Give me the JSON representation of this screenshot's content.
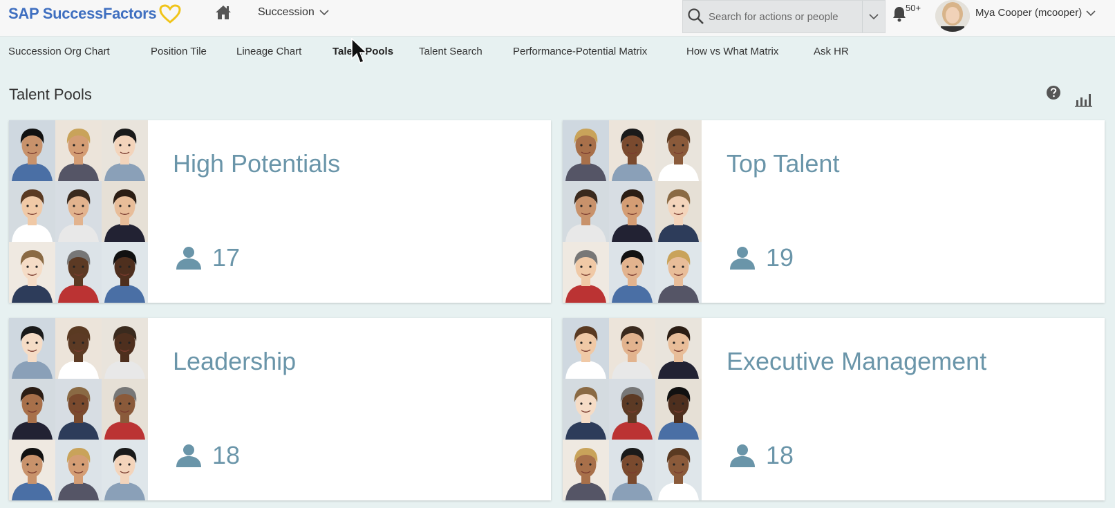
{
  "header": {
    "brand": "SAP SuccessFactors",
    "module": "Succession",
    "search_placeholder": "Search for actions or people",
    "notification_count": "50+",
    "user_name": "Mya Cooper (mcooper)"
  },
  "subnav": {
    "items": [
      {
        "label": "Succession Org Chart"
      },
      {
        "label": "Position Tile"
      },
      {
        "label": "Lineage Chart"
      },
      {
        "label": "Talent Pools",
        "active": true
      },
      {
        "label": "Talent Search"
      },
      {
        "label": "Performance-Potential Matrix"
      },
      {
        "label": "How vs What Matrix"
      },
      {
        "label": "Ask HR"
      }
    ]
  },
  "page": {
    "title": "Talent Pools"
  },
  "pools": [
    {
      "name": "High Potentials",
      "count": "17"
    },
    {
      "name": "Top Talent",
      "count": "19"
    },
    {
      "name": "Leadership",
      "count": "18"
    },
    {
      "name": "Executive Management",
      "count": "18"
    }
  ],
  "colors": {
    "brand": "#3f6fc0",
    "pool_text": "#6a95a9",
    "background": "#e7f1f1"
  }
}
